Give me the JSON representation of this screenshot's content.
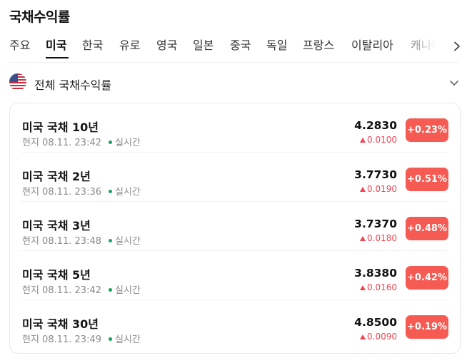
{
  "header": {
    "title": "국채수익률"
  },
  "tabs": [
    {
      "label": "주요"
    },
    {
      "label": "미국"
    },
    {
      "label": "한국"
    },
    {
      "label": "유로"
    },
    {
      "label": "영국"
    },
    {
      "label": "일본"
    },
    {
      "label": "중국"
    },
    {
      "label": "독일"
    },
    {
      "label": "프랑스"
    },
    {
      "label": "이탈리아"
    },
    {
      "label": "캐나다"
    }
  ],
  "active_tab": "미국",
  "section": {
    "title": "전체 국채수익률",
    "flag_icon": "us-flag-icon",
    "toggle_icon": "chevron-down-icon"
  },
  "bonds": [
    {
      "name": "미국 국채 10년",
      "date": "현지 08.11. 23:42",
      "status": "실시간",
      "value": "4.2830",
      "change": "0.0100",
      "percent": "+0.23%"
    },
    {
      "name": "미국 국채 2년",
      "date": "현지 08.11. 23:36",
      "status": "실시간",
      "value": "3.7730",
      "change": "0.0190",
      "percent": "+0.51%"
    },
    {
      "name": "미국 국채 3년",
      "date": "현지 08.11. 23:48",
      "status": "실시간",
      "value": "3.7370",
      "change": "0.0180",
      "percent": "+0.48%"
    },
    {
      "name": "미국 국채 5년",
      "date": "현지 08.11. 23:42",
      "status": "실시간",
      "value": "3.8380",
      "change": "0.0160",
      "percent": "+0.42%"
    },
    {
      "name": "미국 국채 30년",
      "date": "현지 08.11. 23:49",
      "status": "실시간",
      "value": "4.8500",
      "change": "0.0090",
      "percent": "+0.19%"
    }
  ],
  "colors": {
    "up": "#f04452",
    "badge": "#f55b52",
    "live": "#1aa260"
  }
}
